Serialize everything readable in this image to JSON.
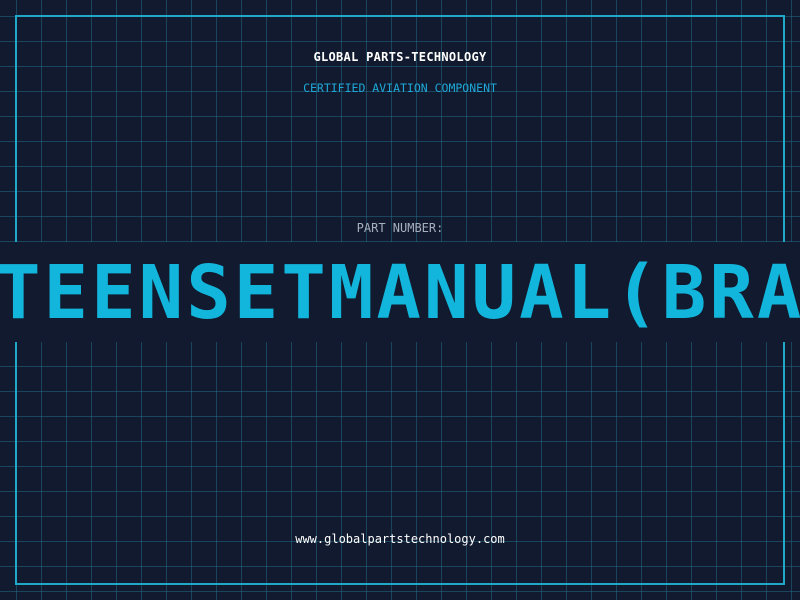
{
  "header": {
    "brand": "GLOBAL PARTS-TECHNOLOGY",
    "subtitle": "CERTIFIED AVIATION COMPONENT"
  },
  "part": {
    "label": "PART NUMBER:",
    "number": "TEENSETMANUAL(BRAZ"
  },
  "footer": {
    "url": "www.globalpartstechnology.com"
  },
  "colors": {
    "background": "#111a2e",
    "accent": "#12b6dc",
    "grid": "#287896"
  }
}
